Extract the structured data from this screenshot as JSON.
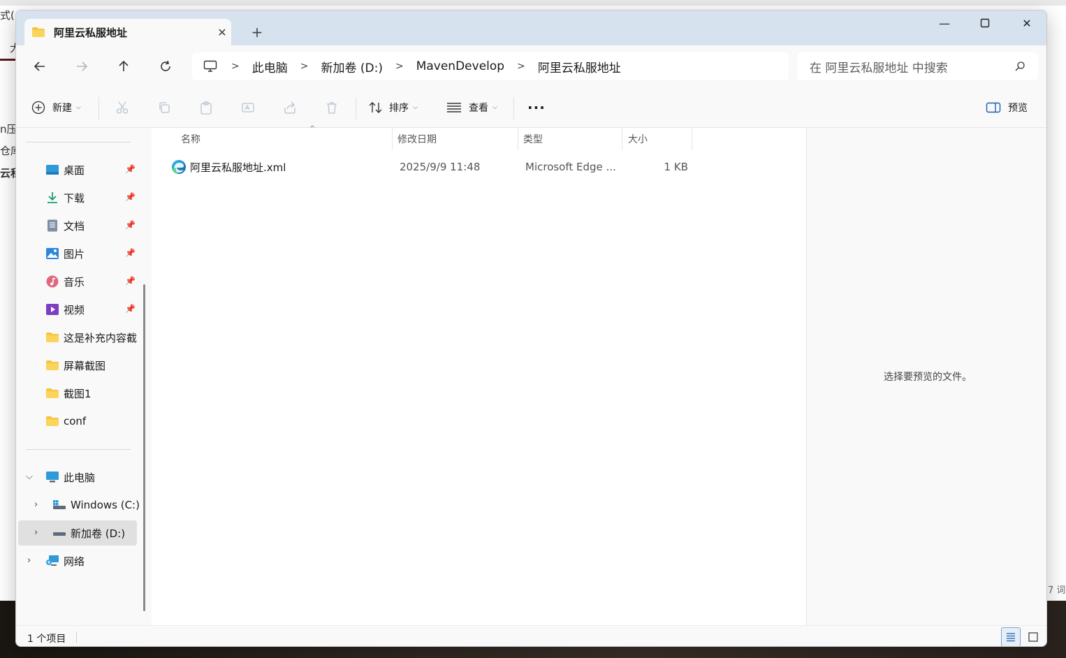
{
  "background": {
    "fragments": [
      "式(",
      "大",
      "n压",
      "仓库",
      "云私"
    ],
    "right_text": "7 词"
  },
  "window": {
    "tab_title": "阿里云私服地址",
    "new_tab_symbol": "+",
    "controls": {
      "minimize": "—",
      "maximize": "☐",
      "close": "✕"
    }
  },
  "address": {
    "breadcrumbs": [
      "此电脑",
      "新加卷 (D:)",
      "MavenDevelop",
      "阿里云私服地址"
    ],
    "search_placeholder": "在 阿里云私服地址 中搜索"
  },
  "toolbar": {
    "new_label": "新建",
    "sort_label": "排序",
    "view_label": "查看",
    "more_label": "···",
    "preview_label": "预览"
  },
  "sidebar": {
    "quick_access": [
      {
        "label": "桌面",
        "icon": "desktop-icon",
        "pinned": true
      },
      {
        "label": "下载",
        "icon": "download-icon",
        "pinned": true
      },
      {
        "label": "文档",
        "icon": "document-icon",
        "pinned": true
      },
      {
        "label": "图片",
        "icon": "pictures-icon",
        "pinned": true
      },
      {
        "label": "音乐",
        "icon": "music-icon",
        "pinned": true
      },
      {
        "label": "视频",
        "icon": "video-icon",
        "pinned": true
      },
      {
        "label": "这是补充内容截",
        "icon": "folder-icon",
        "pinned": false
      },
      {
        "label": "屏幕截图",
        "icon": "folder-icon",
        "pinned": false
      },
      {
        "label": "截图1",
        "icon": "folder-icon",
        "pinned": false
      },
      {
        "label": "conf",
        "icon": "folder-icon",
        "pinned": false
      }
    ],
    "this_pc": "此电脑",
    "drives": [
      "Windows (C:)",
      "新加卷 (D:)"
    ],
    "network": "网络"
  },
  "columns": {
    "name": "名称",
    "modified": "修改日期",
    "type": "类型",
    "size": "大小"
  },
  "files": [
    {
      "name": "阿里云私服地址.xml",
      "modified": "2025/9/9 11:48",
      "type": "Microsoft Edge ...",
      "size": "1 KB",
      "icon": "edge-icon"
    }
  ],
  "preview": {
    "message": "选择要预览的文件。"
  },
  "status": {
    "item_count": "1 个项目"
  },
  "colors": {
    "titlebar": "#d6e2ee",
    "folder": "#f4c542",
    "accent": "#0067c0"
  }
}
